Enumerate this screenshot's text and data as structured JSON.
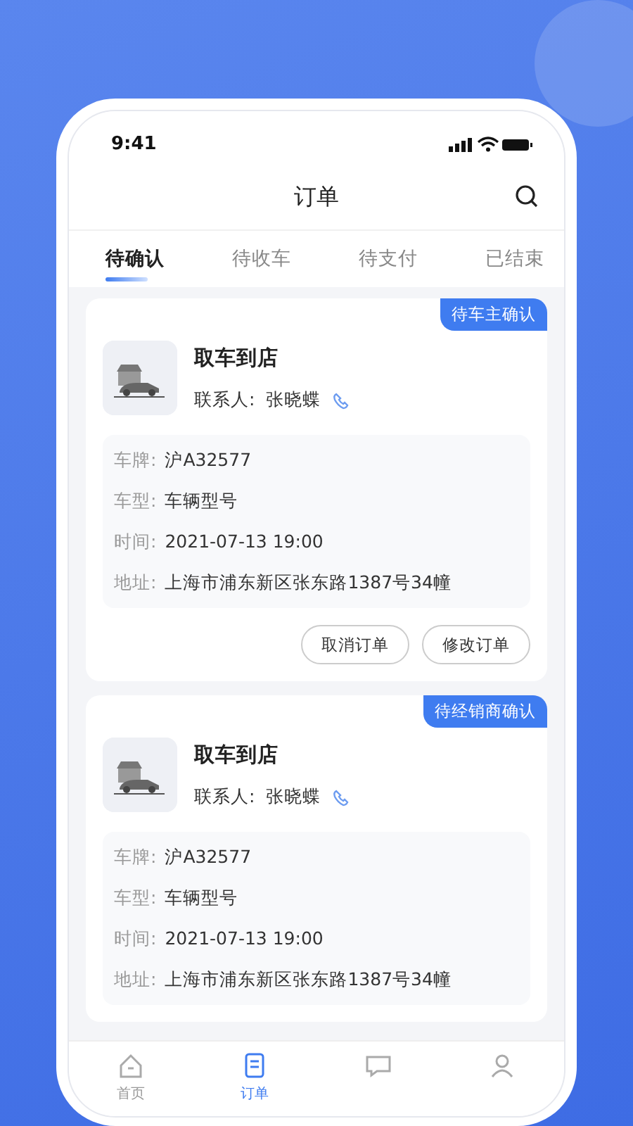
{
  "status_bar": {
    "time": "9:41"
  },
  "header": {
    "title": "订单"
  },
  "tabs": [
    {
      "label": "待确认",
      "selected": true
    },
    {
      "label": "待收车",
      "selected": false
    },
    {
      "label": "待支付",
      "selected": false
    },
    {
      "label": "已结束",
      "selected": false
    }
  ],
  "orders": [
    {
      "badge": "待车主确认",
      "title": "取车到店",
      "contact_label": "联系人:",
      "contact_name": "张晓蝶",
      "fields": [
        {
          "label": "车牌:",
          "value": "沪A32577"
        },
        {
          "label": "车型:",
          "value": "车辆型号"
        },
        {
          "label": "时间:",
          "value": "2021-07-13 19:00"
        },
        {
          "label": "地址:",
          "value": "上海市浦东新区张东路1387号34幢"
        }
      ],
      "buttons": [
        "取消订单",
        "修改订单"
      ]
    },
    {
      "badge": "待经销商确认",
      "title": "取车到店",
      "contact_label": "联系人:",
      "contact_name": "张晓蝶",
      "fields": [
        {
          "label": "车牌:",
          "value": "沪A32577"
        },
        {
          "label": "车型:",
          "value": "车辆型号"
        },
        {
          "label": "时间:",
          "value": "2021-07-13 19:00"
        },
        {
          "label": "地址:",
          "value": "上海市浦东新区张东路1387号34幢"
        }
      ]
    }
  ],
  "bottom_nav": [
    {
      "kind": "home",
      "label": "首页",
      "selected": false
    },
    {
      "kind": "orders",
      "label": "订单",
      "selected": true
    },
    {
      "kind": "message",
      "selected": false
    },
    {
      "kind": "user",
      "selected": false
    }
  ]
}
